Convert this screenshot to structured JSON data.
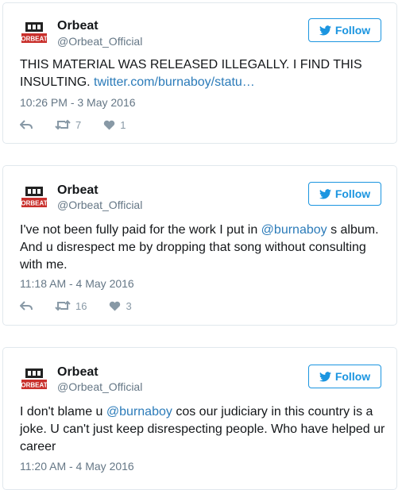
{
  "tweets": [
    {
      "name": "Orbeat",
      "handle": "@Orbeat_Official",
      "follow_label": "Follow",
      "text_parts": [
        "THIS MATERIAL WAS RELEASED ILLEGALLY. I FIND THIS INSULTING. ",
        "twitter.com/burnaboy/statu…"
      ],
      "timestamp": "10:26 PM - 3 May 2016",
      "retweets": "7",
      "likes": "1"
    },
    {
      "name": "Orbeat",
      "handle": "@Orbeat_Official",
      "follow_label": "Follow",
      "text_parts": [
        "I've not been fully paid for the work I put in ",
        "@burnaboy",
        " s album. And u disrespect me by dropping that song without consulting with me."
      ],
      "timestamp": "11:18 AM - 4 May 2016",
      "retweets": "16",
      "likes": "3"
    },
    {
      "name": "Orbeat",
      "handle": "@Orbeat_Official",
      "follow_label": "Follow",
      "text_parts": [
        "I don't blame u ",
        "@burnaboy",
        " cos our judiciary in this country is a joke. U can't just keep disrespecting people. Who have helped ur career"
      ],
      "timestamp": "11:20 AM - 4 May 2016"
    }
  ],
  "avatar_logo_text": "ORBEAT",
  "colors": {
    "accent": "#1b95e0",
    "link": "#2b7bb9",
    "logo_red": "#c9302c"
  }
}
